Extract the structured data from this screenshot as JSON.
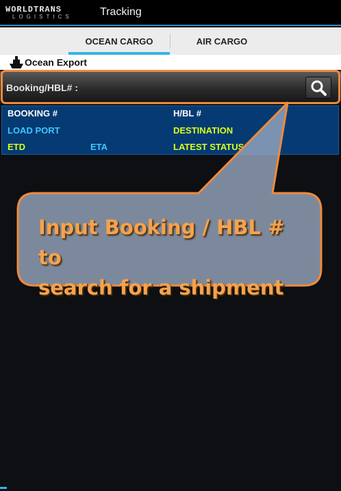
{
  "colors": {
    "accent": "#33b5e5",
    "highlight_border": "#ef8a3c",
    "info_panel_bg": "#053a73",
    "label_white": "#ffffff",
    "label_cyan": "#3ec8ff",
    "label_yellow": "#d9ff1a",
    "callout_text": "#f5a24e"
  },
  "app": {
    "logo_top": "WORLDTRANS",
    "logo_bottom": "LOGISTICS",
    "title": "Tracking"
  },
  "tabs": [
    {
      "label": "OCEAN CARGO",
      "selected": true
    },
    {
      "label": "AIR CARGO",
      "selected": false
    }
  ],
  "section": {
    "icon": "ship-icon",
    "title": "Ocean Export"
  },
  "search": {
    "label": "Booking/HBL# :",
    "value": "",
    "placeholder": "",
    "button_icon": "search-icon"
  },
  "info": {
    "booking": "BOOKING #",
    "hbl": "H/BL #",
    "load_port": "LOAD PORT",
    "destination": "DESTINATION",
    "etd": "ETD",
    "eta": "ETA",
    "latest_status": "LATEST STATUS"
  },
  "callout": {
    "line1": "Input Booking / HBL # to",
    "line2": "search for a shipment"
  }
}
